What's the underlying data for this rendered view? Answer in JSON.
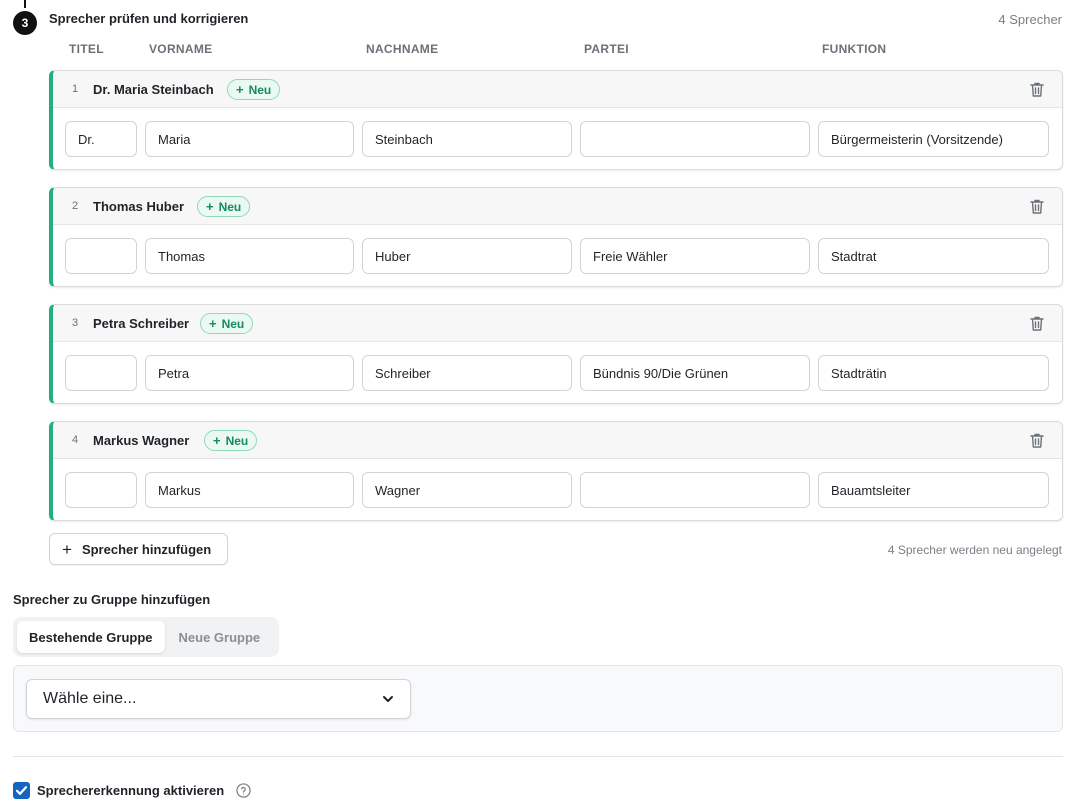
{
  "step": {
    "number": "3",
    "title": "Sprecher prüfen und korrigieren",
    "count": "4 Sprecher"
  },
  "columns": {
    "titel": "TITEL",
    "vorname": "VORNAME",
    "nachname": "NACHNAME",
    "partei": "PARTEI",
    "funktion": "FUNKTION"
  },
  "speakers": [
    {
      "index": "1",
      "display_name": "Dr. Maria Steinbach",
      "badge": "Neu",
      "titel": "Dr.",
      "vorname": "Maria",
      "nachname": "Steinbach",
      "partei": "",
      "funktion": "Bürgermeisterin (Vorsitzende)"
    },
    {
      "index": "2",
      "display_name": "Thomas Huber",
      "badge": "Neu",
      "titel": "",
      "vorname": "Thomas",
      "nachname": "Huber",
      "partei": "Freie Wähler",
      "funktion": "Stadtrat"
    },
    {
      "index": "3",
      "display_name": "Petra Schreiber",
      "badge": "Neu",
      "titel": "",
      "vorname": "Petra",
      "nachname": "Schreiber",
      "partei": "Bündnis 90/Die Grünen",
      "funktion": "Stadträtin"
    },
    {
      "index": "4",
      "display_name": "Markus Wagner",
      "badge": "Neu",
      "titel": "",
      "vorname": "Markus",
      "nachname": "Wagner",
      "partei": "",
      "funktion": "Bauamtsleiter"
    }
  ],
  "add_speaker": {
    "label": "Sprecher hinzufügen",
    "note": "4 Sprecher werden neu angelegt"
  },
  "group": {
    "title": "Sprecher zu Gruppe hinzufügen",
    "tab_existing": "Bestehende Gruppe",
    "tab_new": "Neue Gruppe",
    "active_tab": "Bestehende Gruppe",
    "select_value": "Wähle eine..."
  },
  "recognition": {
    "label": "Sprechererkennung aktivieren",
    "checked": true
  },
  "colors": {
    "accent_green": "#22b07d",
    "checkbox_blue": "#1565c0"
  }
}
